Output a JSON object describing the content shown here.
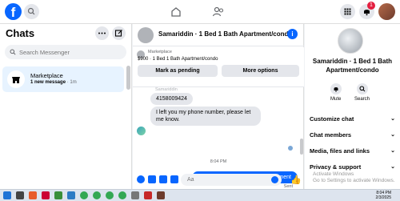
{
  "nav": {
    "logo": "f",
    "notification_count": "1"
  },
  "left": {
    "title": "Chats",
    "search_placeholder": "Search Messenger",
    "chat": {
      "name": "Marketplace",
      "preview": "1 new message",
      "time": "· 1m"
    }
  },
  "conversation": {
    "title": "Samariddin · 1 Bed 1 Bath Apartment/condo",
    "listing_category": "Marketplace",
    "listing_price": "$900 · 1 Bed 1 Bath Apartment/condo",
    "mark_pending_label": "Mark as pending",
    "more_options_label": "More options",
    "faded_text": "Samariddin",
    "messages_in": [
      "4158009424",
      "I left you my phone number, please let me know."
    ],
    "time_separator": "8:04 PM",
    "message_out": "Thanks I\"ll message you in a moment",
    "sent_label": "Sent",
    "composer_placeholder": "Aa"
  },
  "right": {
    "name": "Samariddin · 1 Bed 1 Bath Apartment/condo",
    "mute_label": "Mute",
    "search_label": "Search",
    "sections": [
      "Customize chat",
      "Chat members",
      "Media, files and links",
      "Privacy & support"
    ],
    "watermark_line1": "Activate Windows",
    "watermark_line2": "Go to Settings to activate Windows."
  },
  "taskbar": {
    "time": "8:04 PM",
    "date": "2/3/2025"
  },
  "colors": {
    "brand": "#0866ff",
    "badge": "#e41e3f"
  }
}
